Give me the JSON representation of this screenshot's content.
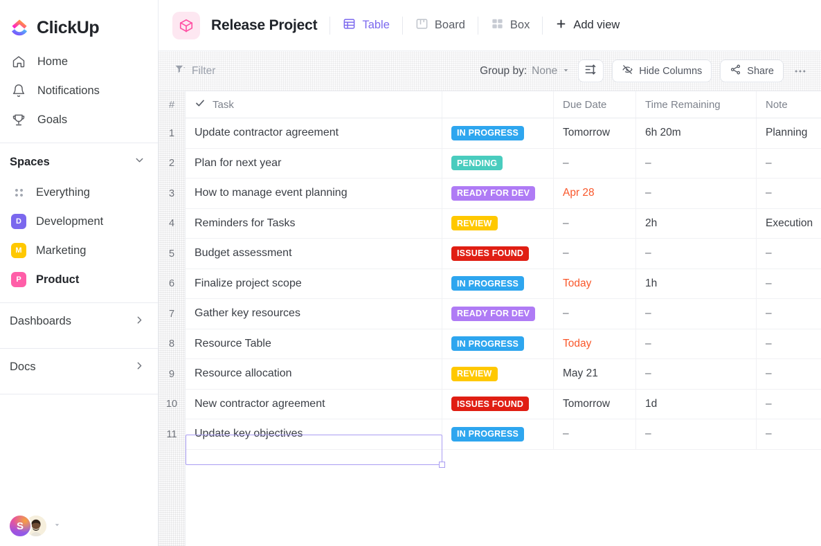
{
  "brand": {
    "name": "ClickUp"
  },
  "sidebar": {
    "nav": [
      {
        "label": "Home",
        "icon": "home-icon"
      },
      {
        "label": "Notifications",
        "icon": "bell-icon"
      },
      {
        "label": "Goals",
        "icon": "trophy-icon"
      }
    ],
    "spaces_title": "Spaces",
    "spaces": [
      {
        "label": "Everything",
        "icon": "dots-grid-icon",
        "avatar": "",
        "color": "",
        "bold": false
      },
      {
        "label": "Development",
        "avatar": "D",
        "color": "#7b68ee",
        "bold": false
      },
      {
        "label": "Marketing",
        "avatar": "M",
        "color": "#ffc800",
        "bold": false
      },
      {
        "label": "Product",
        "avatar": "P",
        "color": "#ff5ea8",
        "bold": true
      }
    ],
    "sections": [
      {
        "label": "Dashboards"
      },
      {
        "label": "Docs"
      }
    ],
    "avatar_initial": "S"
  },
  "header": {
    "project_name": "Release Project",
    "project_icon": "box-icon",
    "views": [
      {
        "label": "Table",
        "icon": "table-icon",
        "active": true
      },
      {
        "label": "Board",
        "icon": "board-icon",
        "active": false
      },
      {
        "label": "Box",
        "icon": "box-grid-icon",
        "active": false
      }
    ],
    "add_view": "Add view"
  },
  "toolbar": {
    "filter": "Filter",
    "group_by_label": "Group by:",
    "group_by_value": "None",
    "sort_icon": "sort-icon",
    "hide_columns": "Hide Columns",
    "share": "Share",
    "more": "•••"
  },
  "table": {
    "columns": [
      "#",
      "Task",
      "",
      "Due Date",
      "Time Remaining",
      "Note"
    ],
    "rows": [
      {
        "n": "1",
        "task": "Update contractor agreement",
        "status": "IN PROGRESS",
        "status_color": "#2ea6ef",
        "due": "Tomorrow",
        "due_urgent": false,
        "time": "6h 20m",
        "note": "Planning"
      },
      {
        "n": "2",
        "task": "Plan for next year",
        "status": "PENDING",
        "status_color": "#49ccbe",
        "due": "–",
        "due_urgent": false,
        "time": "–",
        "note": "–"
      },
      {
        "n": "3",
        "task": "How to manage event planning",
        "status": "READY FOR DEV",
        "status_color": "#af7bf5",
        "due": "Apr 28",
        "due_urgent": true,
        "time": "–",
        "note": "–"
      },
      {
        "n": "4",
        "task": "Reminders for Tasks",
        "status": "REVIEW",
        "status_color": "#ffc800",
        "due": "–",
        "due_urgent": false,
        "time": "2h",
        "note": "Execution"
      },
      {
        "n": "5",
        "task": "Budget assessment",
        "status": "ISSUES FOUND",
        "status_color": "#e01e13",
        "due": "–",
        "due_urgent": false,
        "time": "–",
        "note": "–"
      },
      {
        "n": "6",
        "task": "Finalize project scope",
        "status": "IN PROGRESS",
        "status_color": "#2ea6ef",
        "due": "Today",
        "due_urgent": true,
        "time": "1h",
        "note": "–"
      },
      {
        "n": "7",
        "task": "Gather key resources",
        "status": "READY FOR DEV",
        "status_color": "#af7bf5",
        "due": "–",
        "due_urgent": false,
        "time": "–",
        "note": "–"
      },
      {
        "n": "8",
        "task": "Resource Table",
        "status": "IN PROGRESS",
        "status_color": "#2ea6ef",
        "due": "Today",
        "due_urgent": true,
        "time": "–",
        "note": "–"
      },
      {
        "n": "9",
        "task": "Resource allocation",
        "status": "REVIEW",
        "status_color": "#ffc800",
        "due": "May 21",
        "due_urgent": false,
        "time": "–",
        "note": "–"
      },
      {
        "n": "10",
        "task": "New contractor agreement",
        "status": "ISSUES FOUND",
        "status_color": "#e01e13",
        "due": "Tomorrow",
        "due_urgent": false,
        "time": "1d",
        "note": "–"
      },
      {
        "n": "11",
        "task": "Update key objectives",
        "status": "IN PROGRESS",
        "status_color": "#2ea6ef",
        "due": "–",
        "due_urgent": false,
        "time": "–",
        "note": "–",
        "selected": true
      }
    ]
  },
  "colors": {
    "accent": "#7b68ee",
    "urgent": "#f9572b",
    "selection_border": "#a99cf2"
  }
}
